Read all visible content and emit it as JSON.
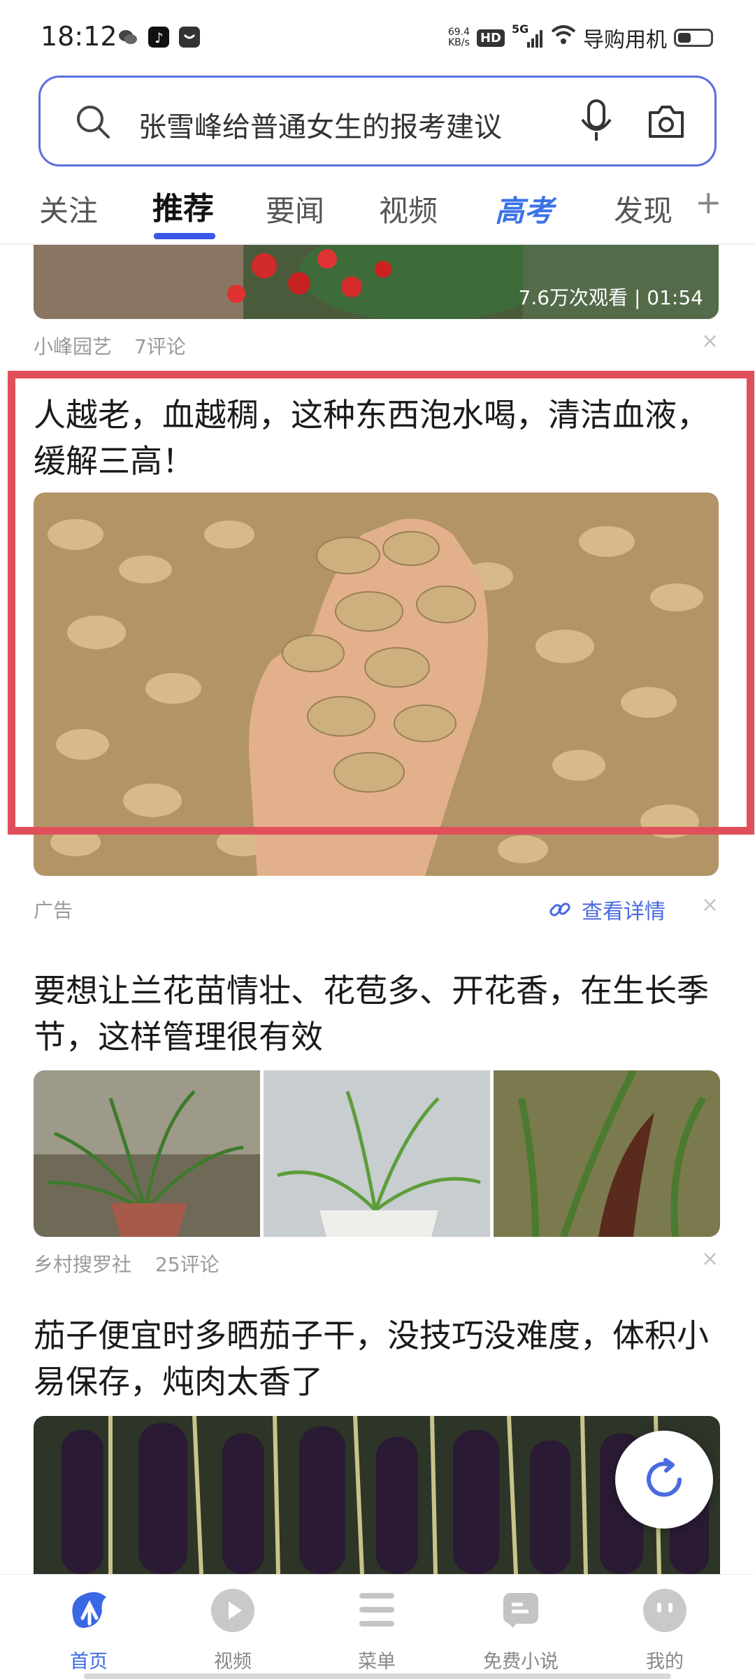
{
  "status_bar": {
    "time": "18:12",
    "net_speed_value": "69.4",
    "net_speed_unit": "KB/s",
    "hd_badge": "HD",
    "signal_label": "5G",
    "carrier_text": "导购用机"
  },
  "search": {
    "query": "张雪峰给普通女生的报考建议"
  },
  "tabs": [
    {
      "label": "关注"
    },
    {
      "label": "推荐"
    },
    {
      "label": "要闻"
    },
    {
      "label": "视频"
    },
    {
      "label": "高考"
    },
    {
      "label": "发现"
    }
  ],
  "add_tab_symbol": "+",
  "feed": {
    "item0": {
      "overlay": "7.6万次观看 | 01:54",
      "author": "小峰园艺",
      "comments": "7评论"
    },
    "item1": {
      "title": "人越老，血越稠，这种东西泡水喝，清洁血液，缓解三高！",
      "ad_label": "广告",
      "detail_link": "查看详情"
    },
    "item2": {
      "title": "要想让兰花苗情壮、花苞多、开花香，在生长季节，这样管理很有效",
      "author": "乡村搜罗社",
      "comments": "25评论"
    },
    "item3": {
      "title": "茄子便宜时多晒茄子干，没技巧没难度，体积小易保存，炖肉太香了"
    }
  },
  "close_symbol": "×",
  "bottom_nav": [
    {
      "label": "首页"
    },
    {
      "label": "视频"
    },
    {
      "label": "菜单"
    },
    {
      "label": "免费小说"
    },
    {
      "label": "我的"
    }
  ],
  "colors": {
    "accent_blue": "#3a57e8",
    "highlight_red": "#e04f5a"
  }
}
